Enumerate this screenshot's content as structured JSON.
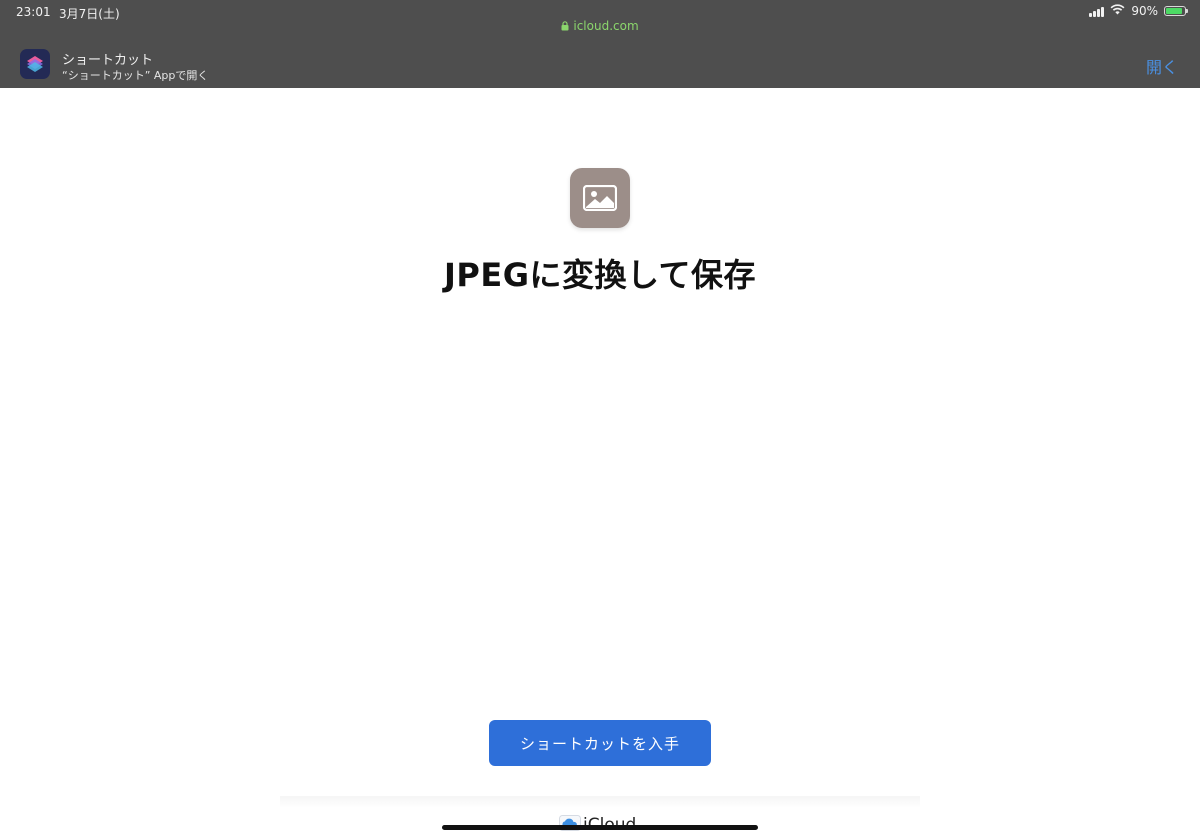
{
  "status_bar": {
    "time": "23:01",
    "date": "3月7日(土)",
    "url": "icloud.com",
    "battery": "90%"
  },
  "app_banner": {
    "app_name": "ショートカット",
    "subtitle": "“ショートカット” Appで開く",
    "open_label": "開く"
  },
  "shortcut": {
    "icon": "image-icon",
    "title": "JPEGに変換して保存",
    "get_button": "ショートカットを入手"
  },
  "footer": {
    "brand": "iCloud"
  },
  "colors": {
    "topbar": "#4e4e4e",
    "accent": "#2e6fd9",
    "url_green": "#8bd66c",
    "shortcut_icon_bg": "#9c8e89"
  }
}
